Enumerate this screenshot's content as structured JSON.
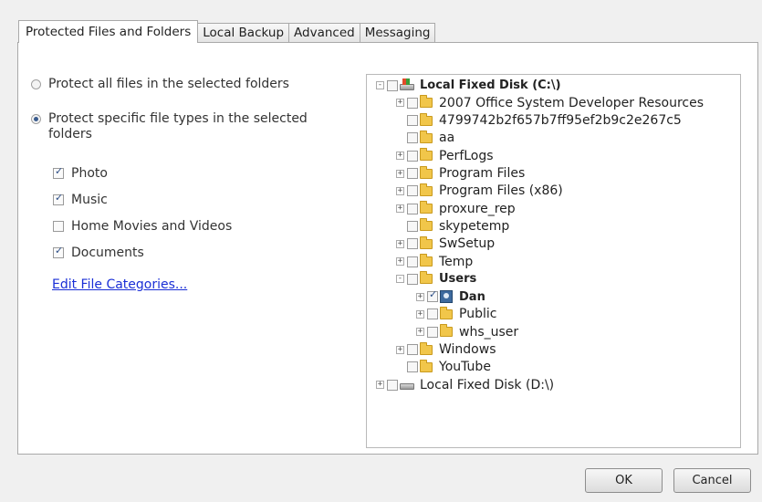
{
  "tabs": [
    {
      "label": "Protected Files and Folders",
      "active": true
    },
    {
      "label": "Local Backup",
      "active": false
    },
    {
      "label": "Advanced",
      "active": false
    },
    {
      "label": "Messaging",
      "active": false
    }
  ],
  "options": {
    "protect_all_label": "Protect all files in the selected folders",
    "protect_all_selected": false,
    "protect_specific_label": "Protect specific file types in the selected folders",
    "protect_specific_selected": true
  },
  "file_types": [
    {
      "label": "Photo",
      "checked": true
    },
    {
      "label": "Music",
      "checked": true
    },
    {
      "label": "Home Movies and Videos",
      "checked": false
    },
    {
      "label": "Documents",
      "checked": true
    }
  ],
  "edit_categories_link": "Edit File Categories...",
  "tree": [
    {
      "label": "Local Fixed Disk (C:\\)",
      "expander": "−",
      "checked": false,
      "icon": "drive-system-icon",
      "bold": true
    },
    {
      "label": "2007 Office System Developer Resources",
      "expander": "+",
      "checked": false,
      "icon": "folder-icon",
      "bold": false
    },
    {
      "label": "4799742b2f657b7ff95ef2b9c2e267c5",
      "expander": "",
      "checked": false,
      "icon": "folder-icon",
      "bold": false
    },
    {
      "label": "aa",
      "expander": "",
      "checked": false,
      "icon": "folder-icon",
      "bold": false
    },
    {
      "label": "PerfLogs",
      "expander": "+",
      "checked": false,
      "icon": "folder-icon",
      "bold": false
    },
    {
      "label": "Program Files",
      "expander": "+",
      "checked": false,
      "icon": "folder-icon",
      "bold": false
    },
    {
      "label": "Program Files (x86)",
      "expander": "+",
      "checked": false,
      "icon": "folder-icon",
      "bold": false
    },
    {
      "label": "proxure_rep",
      "expander": "+",
      "checked": false,
      "icon": "folder-icon",
      "bold": false
    },
    {
      "label": "skypetemp",
      "expander": "",
      "checked": false,
      "icon": "folder-icon",
      "bold": false
    },
    {
      "label": "SwSetup",
      "expander": "+",
      "checked": false,
      "icon": "folder-icon",
      "bold": false
    },
    {
      "label": "Temp",
      "expander": "+",
      "checked": false,
      "icon": "folder-icon",
      "bold": false
    },
    {
      "label": "Users",
      "expander": "−",
      "checked": false,
      "icon": "folder-icon",
      "bold": true
    },
    {
      "label": "Dan",
      "expander": "+",
      "checked": true,
      "icon": "user-folder-icon",
      "bold": true
    },
    {
      "label": "Public",
      "expander": "+",
      "checked": false,
      "icon": "folder-icon",
      "bold": false
    },
    {
      "label": "whs_user",
      "expander": "+",
      "checked": false,
      "icon": "folder-icon",
      "bold": false
    },
    {
      "label": "Windows",
      "expander": "+",
      "checked": false,
      "icon": "folder-icon",
      "bold": false
    },
    {
      "label": "YouTube",
      "expander": "",
      "checked": false,
      "icon": "folder-icon",
      "bold": false
    },
    {
      "label": "Local Fixed Disk (D:\\)",
      "expander": "+",
      "checked": false,
      "icon": "drive-icon",
      "bold": false
    }
  ],
  "buttons": {
    "ok": "OK",
    "cancel": "Cancel"
  }
}
